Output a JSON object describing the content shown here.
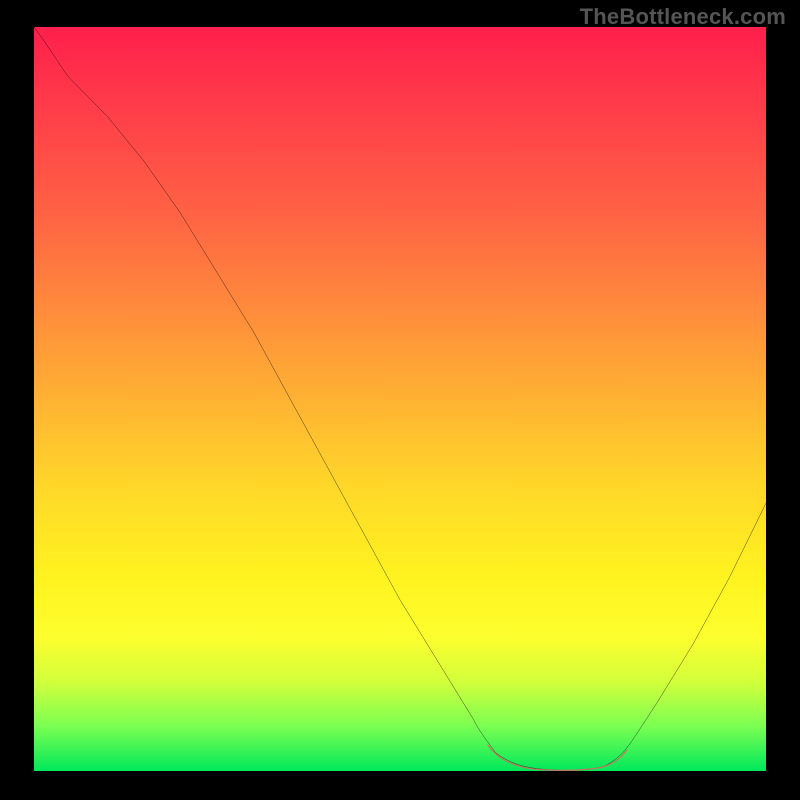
{
  "watermark": "TheBottleneck.com",
  "colors": {
    "background": "#000000",
    "curve": "#000000",
    "highlight": "#d66a60",
    "grad_top": "#ff1f4b",
    "grad_mid": "#fff31f",
    "grad_bot": "#00e85a"
  },
  "chart_data": {
    "type": "line",
    "title": "",
    "xlabel": "",
    "ylabel": "",
    "xlim": [
      0,
      100
    ],
    "ylim": [
      0,
      100
    ],
    "series": [
      {
        "name": "bottleneck-curve",
        "x": [
          0,
          5,
          10,
          15,
          20,
          25,
          30,
          35,
          40,
          45,
          50,
          55,
          60,
          62,
          65,
          68,
          72,
          75,
          78,
          80,
          85,
          90,
          95,
          100
        ],
        "y": [
          100,
          97,
          93,
          88,
          82,
          75,
          67,
          59,
          50,
          41,
          32,
          23,
          13,
          8,
          3,
          1,
          0,
          0,
          1,
          3,
          9,
          17,
          26,
          36
        ]
      }
    ],
    "annotations": [
      {
        "name": "flat-minimum-highlight",
        "x_range": [
          62,
          80
        ],
        "color": "#d66a60"
      }
    ]
  }
}
